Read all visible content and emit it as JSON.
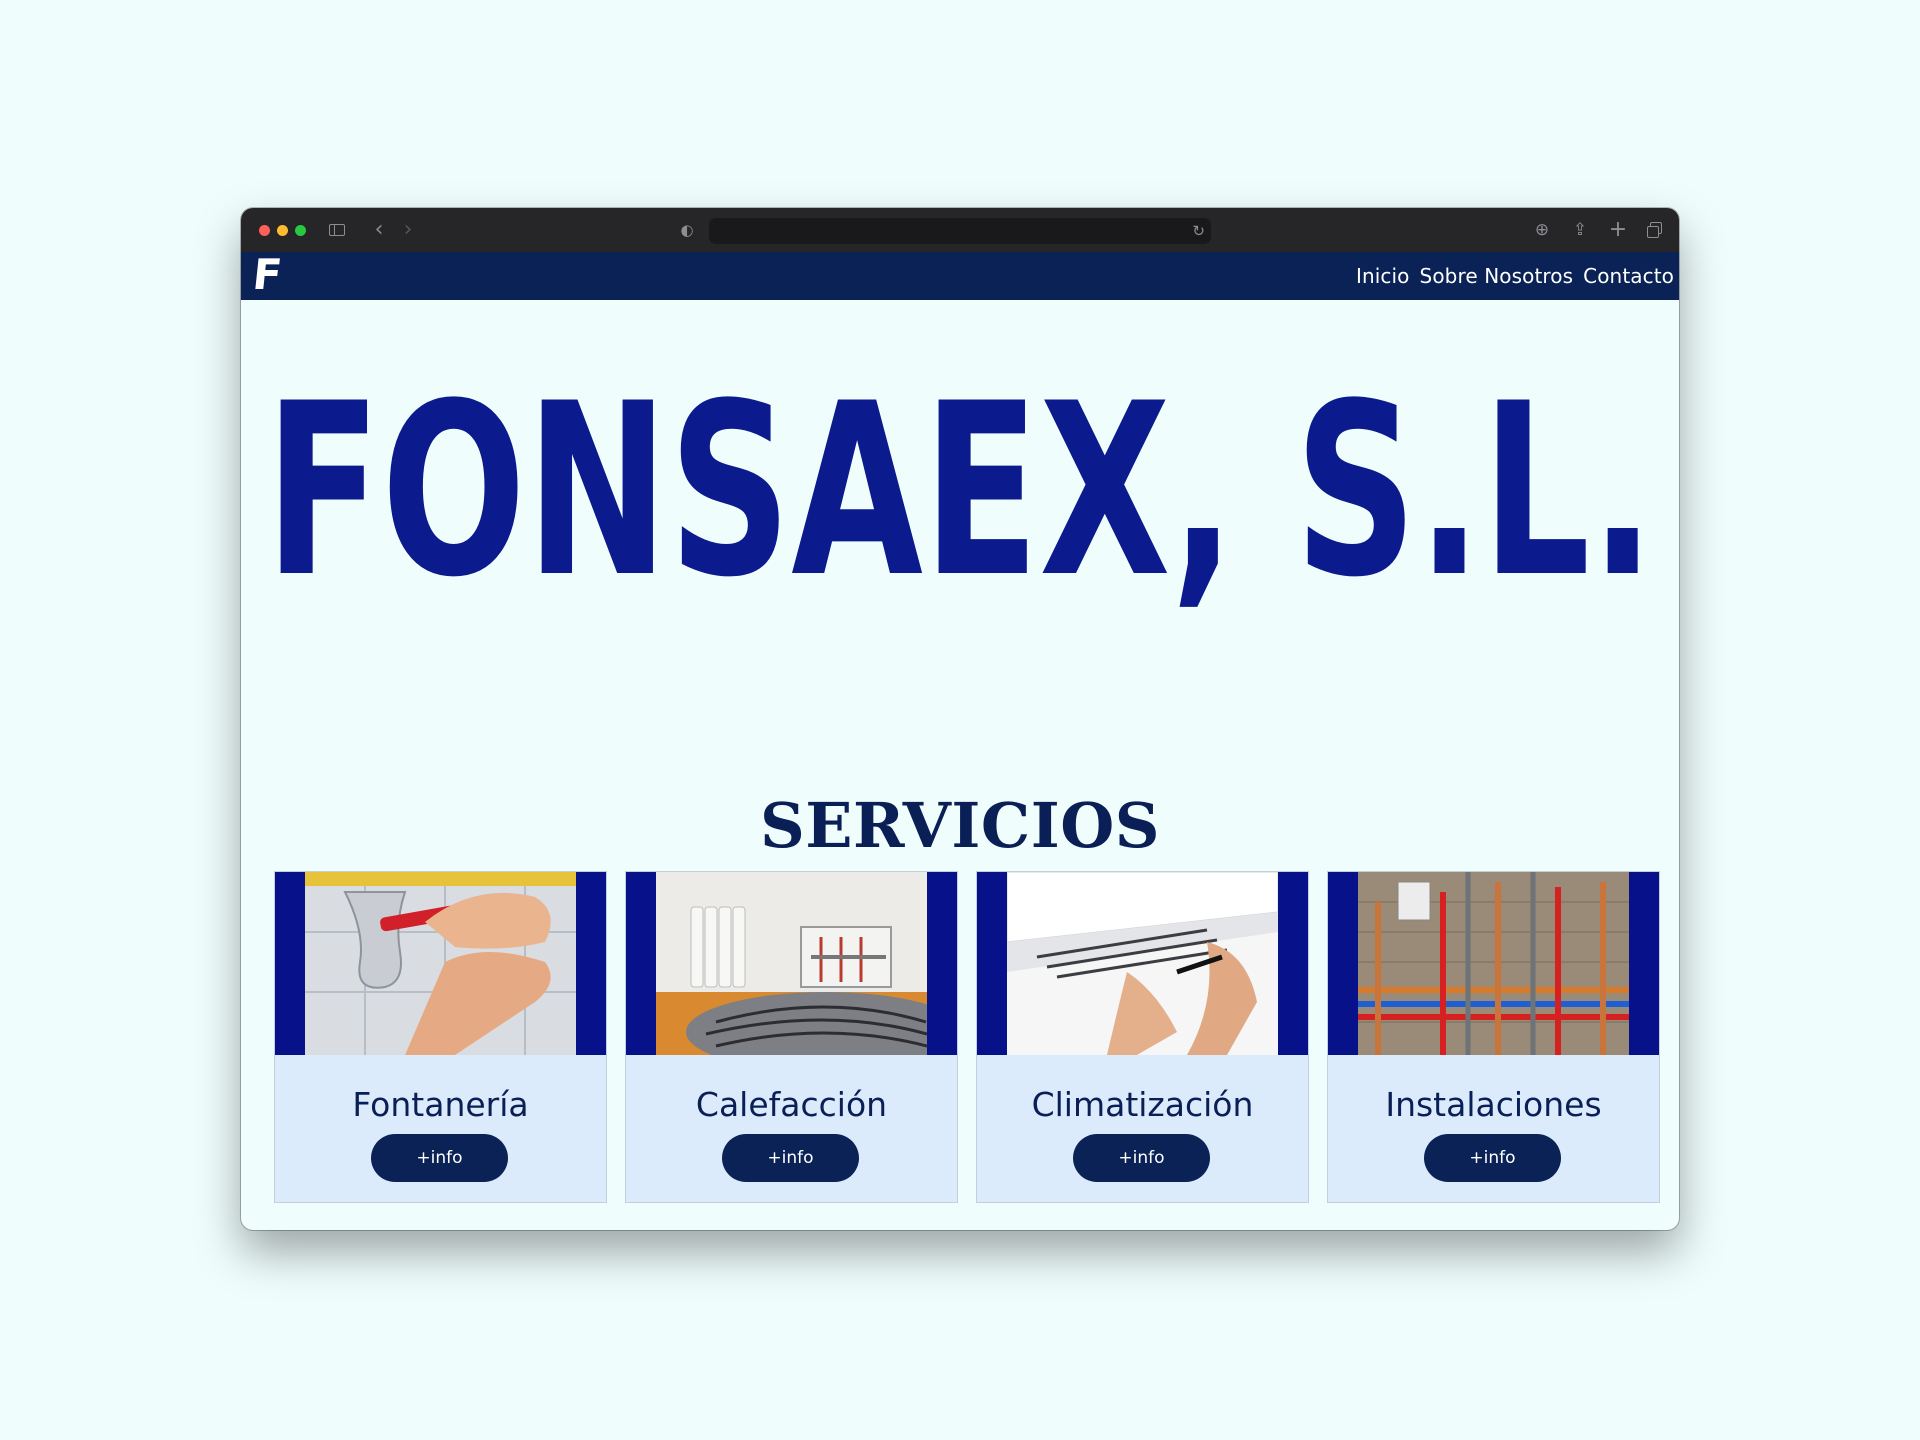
{
  "nav": {
    "logo": "F",
    "links": [
      "Inicio",
      "Sobre Nosotros",
      "Contacto"
    ]
  },
  "brand": "FONSAEX, S.L.",
  "section_title": "SERVICIOS",
  "services": [
    {
      "title": "Fontanería",
      "button": "+info"
    },
    {
      "title": "Calefacción",
      "button": "+info"
    },
    {
      "title": "Climatización",
      "button": "+info"
    },
    {
      "title": "Instalaciones",
      "button": "+info"
    }
  ],
  "colors": {
    "page_bg": "#effdfd",
    "nav_bg": "#0a2256",
    "brand_blue": "#0b1a8c",
    "card_bg": "#dcebfc",
    "card_frame": "#07128a"
  },
  "browser_icons": [
    "sidebar-icon",
    "back-icon",
    "forward-icon",
    "shield-icon",
    "reload-icon",
    "download-icon",
    "share-icon",
    "new-tab-icon",
    "tabs-overview-icon"
  ]
}
